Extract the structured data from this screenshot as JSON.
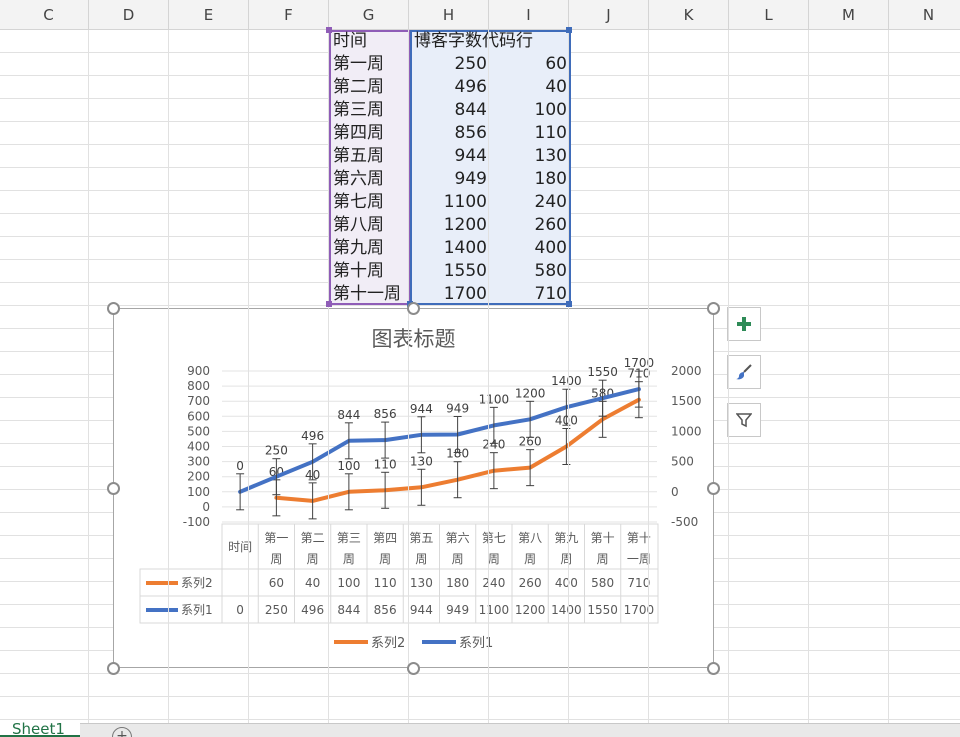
{
  "columns": [
    "C",
    "D",
    "E",
    "F",
    "G",
    "H",
    "I",
    "J",
    "K",
    "L",
    "M",
    "N"
  ],
  "table": {
    "headers": [
      "时间",
      "博客字数",
      "代码行"
    ],
    "rows": [
      [
        "第一周",
        "250",
        "60"
      ],
      [
        "第二周",
        "496",
        "40"
      ],
      [
        "第三周",
        "844",
        "100"
      ],
      [
        "第四周",
        "856",
        "110"
      ],
      [
        "第五周",
        "944",
        "130"
      ],
      [
        "第六周",
        "949",
        "180"
      ],
      [
        "第七周",
        "1100",
        "240"
      ],
      [
        "第八周",
        "1200",
        "260"
      ],
      [
        "第九周",
        "1400",
        "400"
      ],
      [
        "第十周",
        "1550",
        "580"
      ],
      [
        "第十一周",
        "1700",
        "710"
      ]
    ]
  },
  "chart_data": {
    "type": "line",
    "title": "图表标题",
    "categories": [
      "时间",
      "第一周",
      "第二周",
      "第三周",
      "第四周",
      "第五周",
      "第六周",
      "第七周",
      "第八周",
      "第九周",
      "第十周",
      "第十一周"
    ],
    "category_labels_wrapped": [
      [
        "时间"
      ],
      [
        "第一",
        "周"
      ],
      [
        "第二",
        "周"
      ],
      [
        "第三",
        "周"
      ],
      [
        "第四",
        "周"
      ],
      [
        "第五",
        "周"
      ],
      [
        "第六",
        "周"
      ],
      [
        "第七",
        "周"
      ],
      [
        "第八",
        "周"
      ],
      [
        "第九",
        "周"
      ],
      [
        "第十",
        "周"
      ],
      [
        "第十",
        "一周"
      ]
    ],
    "series": [
      {
        "name": "系列2",
        "color": "#ed7d31",
        "axis": "left",
        "values": [
          null,
          60,
          40,
          100,
          110,
          130,
          180,
          240,
          260,
          400,
          580,
          710
        ]
      },
      {
        "name": "系列1",
        "color": "#4472c4",
        "axis": "right",
        "values": [
          0,
          250,
          496,
          844,
          856,
          944,
          949,
          1100,
          1200,
          1400,
          1550,
          1700
        ]
      }
    ],
    "y_left": {
      "min": -100,
      "max": 900,
      "ticks": [
        -100,
        0,
        100,
        200,
        300,
        400,
        500,
        600,
        700,
        800,
        900
      ]
    },
    "y_right": {
      "min": -500,
      "max": 2000,
      "ticks": [
        -500,
        0,
        500,
        1000,
        1500,
        2000
      ]
    },
    "error_bars": true,
    "data_labels": true,
    "data_table": true,
    "legend_position": "bottom",
    "gridlines": true
  },
  "side_buttons": {
    "elements": "chart-elements",
    "styles": "chart-styles",
    "filters": "chart-filters"
  },
  "sheet_tab": "Sheet1",
  "add_sheet": "+"
}
